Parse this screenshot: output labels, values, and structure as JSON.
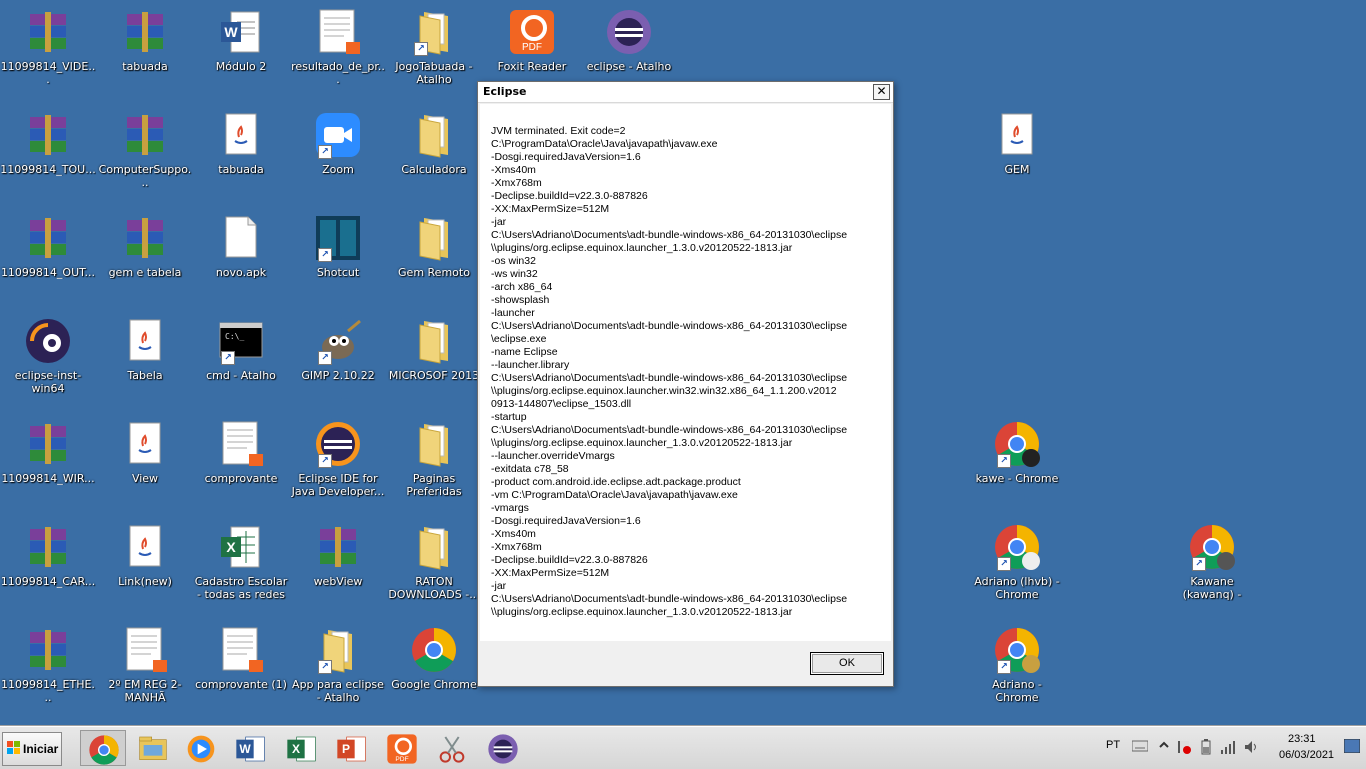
{
  "colors": {
    "desktop": "#3a6ea5",
    "winrar_purple": "#7a3f9a",
    "winrar_green": "#2e8b3a",
    "winrar_blue": "#2b5bb5",
    "folder": "#e8c55a",
    "word_blue": "#2b5797",
    "excel_green": "#1f7244",
    "foxit_orange": "#f26522",
    "eclipse_purple": "#2c2255",
    "zoom_blue": "#2d8cff"
  },
  "desktop_icons": [
    {
      "label": "11099814_VIDE...",
      "icon": "winrar-icon"
    },
    {
      "label": "tabuada",
      "icon": "winrar-icon"
    },
    {
      "label": "Módulo 2",
      "icon": "word-doc-icon"
    },
    {
      "label": "resultado_de_pr...",
      "icon": "pdf-file-icon"
    },
    {
      "label": "JogoTabuada - Atalho",
      "icon": "folder-icon"
    },
    {
      "label": "Foxit Reader",
      "icon": "foxit-icon"
    },
    {
      "label": "eclipse - Atalho",
      "icon": "eclipse-icon"
    },
    {
      "label": "11099814_TOU...",
      "icon": "winrar-icon"
    },
    {
      "label": "ComputerSuppo...",
      "icon": "winrar-icon"
    },
    {
      "label": "tabuada",
      "icon": "java-file-icon"
    },
    {
      "label": "Zoom",
      "icon": "zoom-icon"
    },
    {
      "label": "Calculadora",
      "icon": "folder-icon"
    },
    {
      "label": "GEM",
      "icon": "java-file-icon"
    },
    {
      "label": "11099814_OUT...",
      "icon": "winrar-icon"
    },
    {
      "label": "gem e tabela",
      "icon": "winrar-icon"
    },
    {
      "label": "novo.apk",
      "icon": "blank-file-icon"
    },
    {
      "label": "Shotcut",
      "icon": "shotcut-icon"
    },
    {
      "label": "Gem Remoto",
      "icon": "folder-icon"
    },
    {
      "label": "eclipse-inst-win64",
      "icon": "eclipse-installer-icon"
    },
    {
      "label": "Tabela",
      "icon": "java-file-icon"
    },
    {
      "label": "cmd - Atalho",
      "icon": "cmd-icon"
    },
    {
      "label": "GIMP 2.10.22",
      "icon": "gimp-icon"
    },
    {
      "label": "MICROSOF 2013",
      "icon": "folder-icon"
    },
    {
      "label": "11099814_WIR...",
      "icon": "winrar-icon"
    },
    {
      "label": "View",
      "icon": "java-file-icon"
    },
    {
      "label": "comprovante",
      "icon": "pdf-file-icon"
    },
    {
      "label": "Eclipse IDE for Java Developer...",
      "icon": "eclipse-icon"
    },
    {
      "label": "Paginas Preferidas",
      "icon": "folder-icon"
    },
    {
      "label": "kawe - Chrome",
      "icon": "chrome-profile-icon"
    },
    {
      "label": "11099814_CAR...",
      "icon": "winrar-icon"
    },
    {
      "label": "Link(new)",
      "icon": "java-file-icon"
    },
    {
      "label": "Cadastro Escolar - todas as redes d...",
      "icon": "excel-file-icon"
    },
    {
      "label": "webView",
      "icon": "winrar-icon"
    },
    {
      "label": "RATON DOWNLOADS -...",
      "icon": "folder-icon"
    },
    {
      "label": "Adriano (lhvb) - Chrome",
      "icon": "chrome-profile-icon"
    },
    {
      "label": "Kawane (kawanq) - Chrome",
      "icon": "chrome-profile-icon"
    },
    {
      "label": "11099814_ETHE...",
      "icon": "winrar-icon"
    },
    {
      "label": "2º EM REG 2-MANHÃ",
      "icon": "pdf-file-icon"
    },
    {
      "label": "comprovante (1)",
      "icon": "pdf-file-icon"
    },
    {
      "label": "App para eclipse - Atalho",
      "icon": "folder-icon"
    },
    {
      "label": "Google Chrome",
      "icon": "chrome-icon"
    },
    {
      "label": "Adriano - Chrome",
      "icon": "chrome-profile-icon"
    }
  ],
  "dialog": {
    "title": "Eclipse",
    "close_symbol": "✕",
    "message": "JVM terminated. Exit code=2\nC:\\ProgramData\\Oracle\\Java\\javapath\\javaw.exe\n-Dosgi.requiredJavaVersion=1.6\n-Xms40m\n-Xmx768m\n-Declipse.buildId=v22.3.0-887826\n-XX:MaxPermSize=512M\n-jar\nC:\\Users\\Adriano\\Documents\\adt-bundle-windows-x86_64-20131030\\eclipse\n\\\\plugins/org.eclipse.equinox.launcher_1.3.0.v20120522-1813.jar\n-os win32\n-ws win32\n-arch x86_64\n-showsplash\n-launcher\nC:\\Users\\Adriano\\Documents\\adt-bundle-windows-x86_64-20131030\\eclipse\n\\eclipse.exe\n-name Eclipse\n--launcher.library\nC:\\Users\\Adriano\\Documents\\adt-bundle-windows-x86_64-20131030\\eclipse\n\\\\plugins/org.eclipse.equinox.launcher.win32.win32.x86_64_1.1.200.v2012\n0913-144807\\eclipse_1503.dll\n-startup\nC:\\Users\\Adriano\\Documents\\adt-bundle-windows-x86_64-20131030\\eclipse\n\\\\plugins/org.eclipse.equinox.launcher_1.3.0.v20120522-1813.jar\n--launcher.overrideVmargs\n-exitdata c78_58\n-product com.android.ide.eclipse.adt.package.product\n-vm C:\\ProgramData\\Oracle\\Java\\javapath\\javaw.exe\n-vmargs\n-Dosgi.requiredJavaVersion=1.6\n-Xms40m\n-Xmx768m\n-Declipse.buildId=v22.3.0-887826\n-XX:MaxPermSize=512M\n-jar\nC:\\Users\\Adriano\\Documents\\adt-bundle-windows-x86_64-20131030\\eclipse\n\\\\plugins/org.eclipse.equinox.launcher_1.3.0.v20120522-1813.jar",
    "ok_label": "OK"
  },
  "taskbar": {
    "start_label": "Iniciar",
    "pinned": [
      {
        "icon": "chrome-icon",
        "active": true
      },
      {
        "icon": "explorer-icon",
        "active": false
      },
      {
        "icon": "media-player-icon",
        "active": false
      },
      {
        "icon": "word-icon",
        "active": false
      },
      {
        "icon": "excel-icon",
        "active": false
      },
      {
        "icon": "powerpoint-icon",
        "active": false
      },
      {
        "icon": "foxit-icon",
        "active": false
      },
      {
        "icon": "snipping-tool-icon",
        "active": false
      },
      {
        "icon": "eclipse-icon",
        "active": false
      }
    ],
    "language": "PT",
    "time": "23:31",
    "date": "06/03/2021"
  }
}
